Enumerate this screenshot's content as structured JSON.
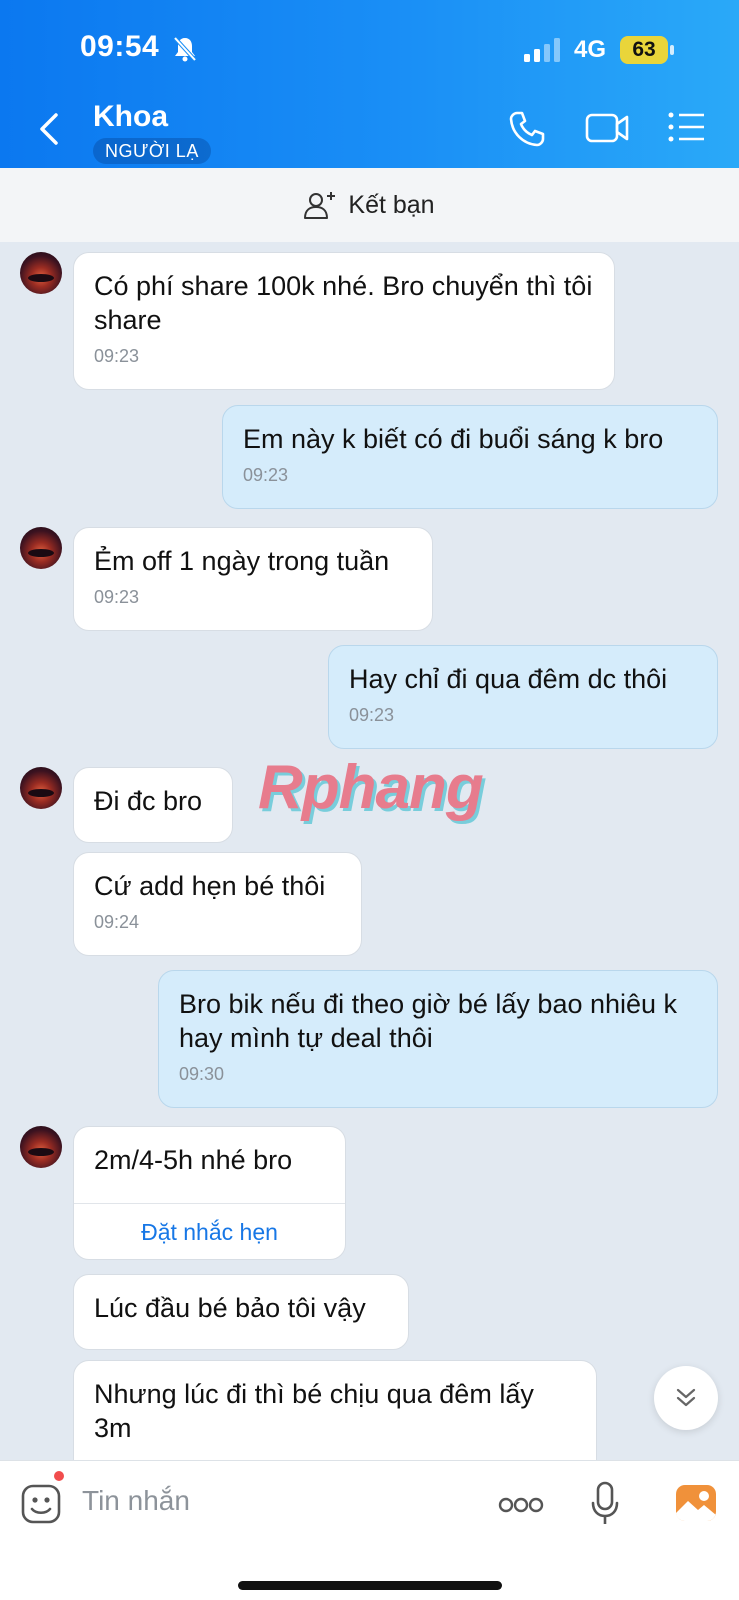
{
  "status_bar": {
    "time": "09:54",
    "network": "4G",
    "battery": "63"
  },
  "header": {
    "contact_name": "Khoa",
    "badge": "NGƯỜI LẠ"
  },
  "friend_bar": {
    "label": "Kết bạn"
  },
  "messages": [
    {
      "side": "in",
      "text": "Có phí share 100k nhé. Bro chuyển thì tôi share",
      "time": "09:23"
    },
    {
      "side": "out",
      "text": "Em này k biết có đi buổi sáng k bro",
      "time": "09:23"
    },
    {
      "side": "in",
      "text": "Ẻm off 1 ngày trong tuần",
      "time": "09:23"
    },
    {
      "side": "out",
      "text": "Hay chỉ đi qua đêm dc thôi",
      "time": "09:23"
    },
    {
      "side": "in",
      "text": "Đi đc bro"
    },
    {
      "side": "in",
      "text": "Cứ add hẹn bé thôi",
      "time": "09:24"
    },
    {
      "side": "out",
      "text": "Bro bik nếu đi theo giờ bé lấy bao nhiêu k hay mình tự deal thôi",
      "time": "09:30"
    },
    {
      "side": "in",
      "text": "2m/4-5h nhé bro",
      "action": "Đặt nhắc hẹn"
    },
    {
      "side": "in",
      "text": "Lúc đầu bé bảo tôi vậy"
    },
    {
      "side": "in",
      "text": "Nhưng lúc đi thì bé chịu qua đêm lấy 3m"
    }
  ],
  "watermark": "Rphang",
  "composer": {
    "placeholder": "Tin nhắn"
  }
}
